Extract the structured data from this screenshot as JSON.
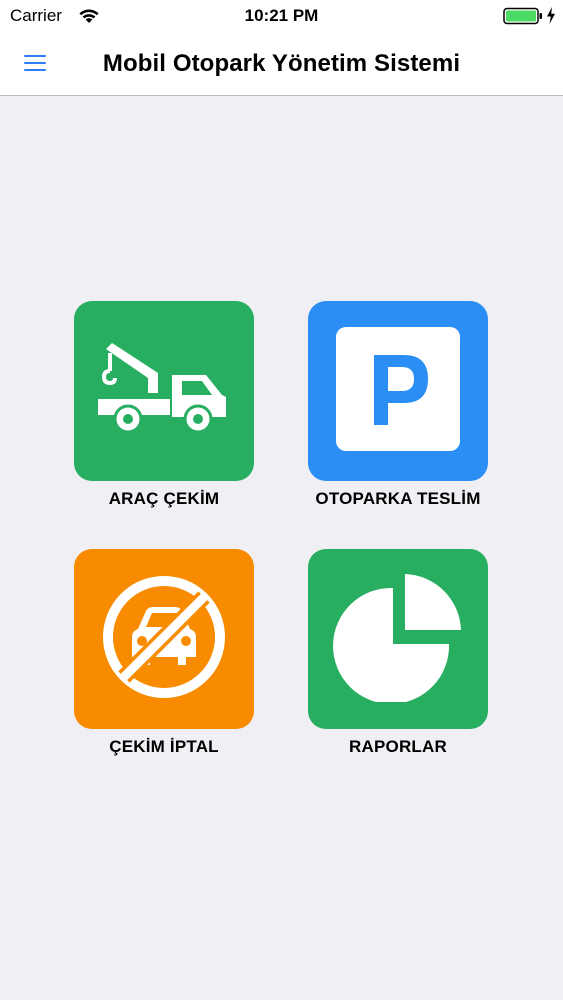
{
  "status_bar": {
    "carrier": "Carrier",
    "time": "10:21 PM",
    "wifi_icon": "wifi-icon",
    "battery_icon": "battery-icon",
    "charging_icon": "bolt-icon"
  },
  "nav": {
    "title": "Mobil Otopark Yönetim Sistemi",
    "menu_icon": "hamburger-menu-icon",
    "accent_color": "#2f7cf6"
  },
  "tiles": [
    {
      "label": "ARAÇ ÇEKİM",
      "icon": "tow-truck-icon",
      "color": "#27ae60"
    },
    {
      "label": "OTOPARKA TESLİM",
      "icon": "parking-icon",
      "color": "#2a8ef4"
    },
    {
      "label": "ÇEKİM İPTAL",
      "icon": "no-car-icon",
      "color": "#f98b00"
    },
    {
      "label": "RAPORLAR",
      "icon": "pie-chart-icon",
      "color": "#27ae60"
    }
  ],
  "colors": {
    "background": "#efeff4",
    "bar_background": "#ffffff"
  }
}
